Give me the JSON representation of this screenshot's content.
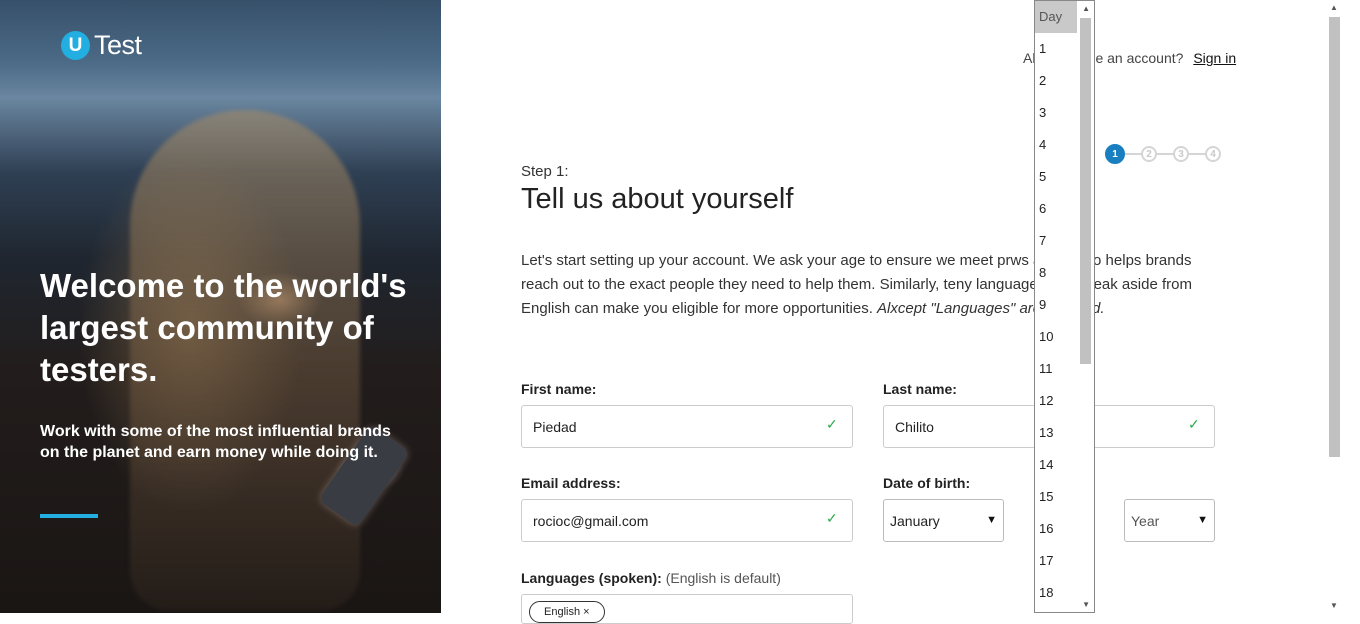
{
  "brand": {
    "badge": "U",
    "word": "Test"
  },
  "hero": {
    "headline": "Welcome to the world's largest community of testers.",
    "subtext": "Work with some of the most influential brands on the planet and earn money while doing it."
  },
  "header": {
    "signin_prefix": "Al",
    "signin_prefix_tail": "e an account?",
    "signin_link": "Sign in"
  },
  "steps": [
    "1",
    "2",
    "3",
    "4"
  ],
  "form": {
    "step_label": "Step 1:",
    "title": "Tell us about yourself",
    "intro_a": "Let's start setting up your account. We ask your age to ensure we meet pr",
    "intro_b": "ws and it also helps brands reach out to the exact people they need to help them. Similarly, te",
    "intro_c": "ny languages you speak aside from English can make you eligible for more opportunities. ",
    "intro_em_a": "Al",
    "intro_em_b": "xcept \"Languages\" are required.",
    "first_name_label": "First name:",
    "first_name_value": "Piedad",
    "last_name_label": "Last name:",
    "last_name_value": "Chilito",
    "email_label": "Email address:",
    "email_value": "rocioc@gmail.com",
    "dob_label": "Date of birth:",
    "dob_month": "January",
    "dob_year": "Year",
    "languages_label": "Languages (spoken):",
    "languages_note": "(English is default)",
    "language_chip": "English ×"
  },
  "day_dropdown": {
    "options": [
      "Day",
      "1",
      "2",
      "3",
      "4",
      "5",
      "6",
      "7",
      "8",
      "9",
      "10",
      "11",
      "12",
      "13",
      "14",
      "15",
      "16",
      "17",
      "18"
    ],
    "selected": "Day"
  },
  "icons": {
    "check": "check-icon",
    "chevron": "chevron-down-icon"
  },
  "colors": {
    "accent": "#22aee0",
    "step_active": "#1a7fc1",
    "valid": "#2cab4a"
  }
}
